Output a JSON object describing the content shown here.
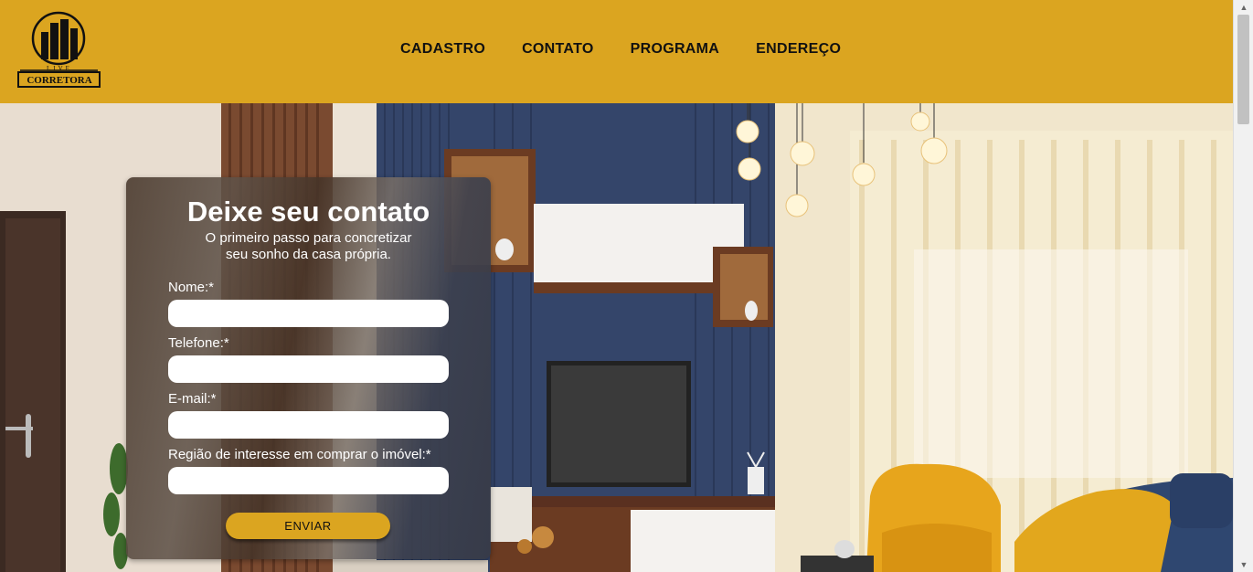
{
  "header": {
    "logo": {
      "line1": "LIVE",
      "line2": "CORRETORA"
    },
    "nav": [
      {
        "label": "CADASTRO"
      },
      {
        "label": "CONTATO"
      },
      {
        "label": "PROGRAMA"
      },
      {
        "label": "ENDEREÇO"
      }
    ]
  },
  "form": {
    "title": "Deixe seu contato",
    "subtitle_line1": "O primeiro passo para concretizar",
    "subtitle_line2": "seu sonho da casa própria.",
    "fields": [
      {
        "label": "Nome:*",
        "value": ""
      },
      {
        "label": "Telefone:*",
        "value": ""
      },
      {
        "label": "E-mail:*",
        "value": ""
      },
      {
        "label": "Região de interesse em comprar o imóvel:*",
        "value": ""
      }
    ],
    "submit_label": "ENVIAR"
  },
  "colors": {
    "brand": "#dba520",
    "text": "#111111",
    "panel_text": "#ffffff"
  },
  "scrollbar": {
    "up_icon": "▲",
    "down_icon": "▼"
  }
}
